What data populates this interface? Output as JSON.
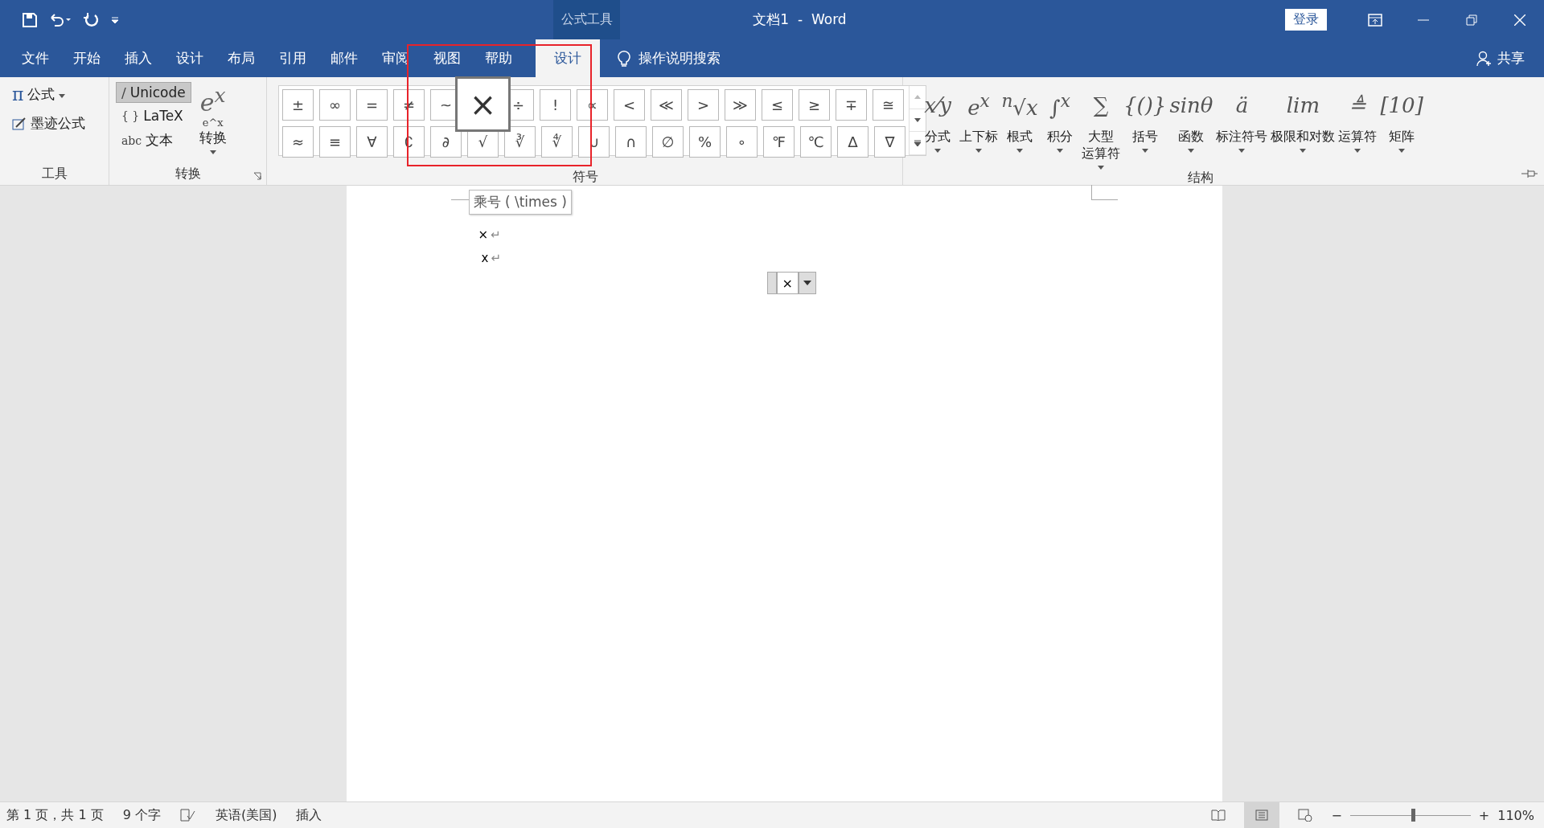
{
  "title_bar": {
    "context_label": "公式工具",
    "title": "文档1  -  Word",
    "sign_in": "登录"
  },
  "tabs": [
    {
      "label": "文件",
      "selected": false
    },
    {
      "label": "开始",
      "selected": false
    },
    {
      "label": "插入",
      "selected": false
    },
    {
      "label": "设计",
      "selected": false
    },
    {
      "label": "布局",
      "selected": false
    },
    {
      "label": "引用",
      "selected": false
    },
    {
      "label": "邮件",
      "selected": false
    },
    {
      "label": "审阅",
      "selected": false
    },
    {
      "label": "视图",
      "selected": false
    },
    {
      "label": "帮助",
      "selected": false
    },
    {
      "label": "设计",
      "selected": true
    }
  ],
  "tell_me": "操作说明搜索",
  "share": "共享",
  "tools_group": {
    "label": "工具",
    "items": [
      {
        "glyph": "π",
        "label": "公式",
        "dropdown": true
      },
      {
        "label": "墨迹公式",
        "dropdown": false
      }
    ]
  },
  "convert_group": {
    "label": "转换",
    "options": [
      {
        "glyph": "/",
        "label": "Unicode",
        "selected": true
      },
      {
        "glyph": "{ }",
        "label": "LaTeX",
        "selected": false
      },
      {
        "glyph": "abc",
        "label": "文本",
        "selected": false
      }
    ],
    "button_main": "e$^{x}$",
    "button_sub": "e^x",
    "button": "转换"
  },
  "symbols_group": {
    "label": "符号",
    "rows": [
      [
        {
          "symbol": "±",
          "hovered": false
        },
        {
          "symbol": "∞",
          "hovered": false
        },
        {
          "symbol": "=",
          "hovered": false
        },
        {
          "symbol": "≠",
          "hovered": false
        },
        {
          "symbol": "~",
          "hovered": false
        },
        {
          "symbol": "×",
          "hovered": true
        },
        {
          "symbol": "÷",
          "hovered": false
        },
        {
          "symbol": "!",
          "hovered": false
        },
        {
          "symbol": "∝",
          "hovered": false
        },
        {
          "symbol": "<",
          "hovered": false
        },
        {
          "symbol": "≪",
          "hovered": false
        },
        {
          "symbol": ">",
          "hovered": false
        },
        {
          "symbol": "≫",
          "hovered": false
        },
        {
          "symbol": "≤",
          "hovered": false
        },
        {
          "symbol": "≥",
          "hovered": false
        },
        {
          "symbol": "∓",
          "hovered": false
        },
        {
          "symbol": "≅",
          "hovered": false
        }
      ],
      [
        {
          "symbol": "≈",
          "hovered": false
        },
        {
          "symbol": "≡",
          "hovered": false
        },
        {
          "symbol": "∀",
          "hovered": false
        },
        {
          "symbol": "∁",
          "hovered": false
        },
        {
          "symbol": "∂",
          "hovered": false
        },
        {
          "symbol": "√",
          "hovered": false
        },
        {
          "symbol": "∛",
          "hovered": false
        },
        {
          "symbol": "∜",
          "hovered": false
        },
        {
          "symbol": "∪",
          "hovered": false
        },
        {
          "symbol": "∩",
          "hovered": false
        },
        {
          "symbol": "∅",
          "hovered": false
        },
        {
          "symbol": "%",
          "hovered": false
        },
        {
          "symbol": "∘",
          "hovered": false
        },
        {
          "symbol": "℉",
          "hovered": false
        },
        {
          "symbol": "℃",
          "hovered": false
        },
        {
          "symbol": "∆",
          "hovered": false
        },
        {
          "symbol": "∇",
          "hovered": false
        }
      ]
    ]
  },
  "structures_group": {
    "label": "结构",
    "items": [
      {
        "glyph": "x⁄y",
        "label_lines": [
          "分式"
        ]
      },
      {
        "glyph": "e$^{x}$",
        "label_lines": [
          "上下标"
        ]
      },
      {
        "glyph": "$^{n}$√x",
        "label_lines": [
          "根式"
        ]
      },
      {
        "glyph": "∫$^{x}$",
        "label_lines": [
          "积分"
        ]
      },
      {
        "glyph": "∑",
        "label_lines": [
          "大型",
          "运算符"
        ]
      },
      {
        "glyph": "{()}",
        "label_lines": [
          "括号"
        ]
      },
      {
        "glyph": "sinθ",
        "label_lines": [
          "函数"
        ]
      },
      {
        "glyph": "ä",
        "label_lines": [
          "标注符号"
        ]
      },
      {
        "glyph": "lim",
        "label_lines": [
          "极限和对数"
        ]
      },
      {
        "glyph": "≜",
        "label_lines": [
          "运算符"
        ]
      },
      {
        "glyph": "[10]",
        "label_lines": [
          "矩阵"
        ]
      }
    ]
  },
  "document": {
    "tooltip": "乘号 ( \\times )",
    "lines": [
      {
        "text": "×",
        "end_mark": "↵"
      },
      {
        "text": "x",
        "end_mark": "↵"
      }
    ],
    "equation": "×"
  },
  "status_bar": {
    "page": "第 1 页，共 1 页",
    "words": "9 个字",
    "language": "英语(美国)",
    "mode": "插入",
    "views": [
      {
        "kind": "read",
        "selected": false
      },
      {
        "kind": "print",
        "selected": true
      },
      {
        "kind": "web",
        "selected": false
      }
    ],
    "zoom_out": "−",
    "zoom_in": "+",
    "zoom": {
      "level": 0.52
    },
    "zoom_reading": "110%"
  }
}
